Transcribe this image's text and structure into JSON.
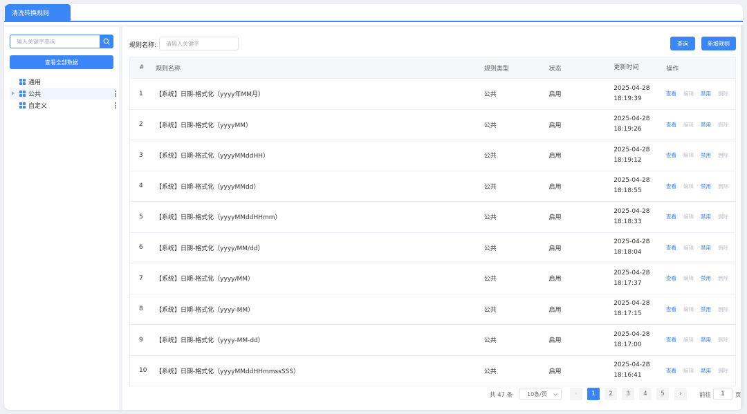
{
  "tab": {
    "label": "清洗转换规则"
  },
  "sidebar": {
    "search_placeholder": "输入关键字查询",
    "view_all_label": "查看全部数据",
    "tree": [
      {
        "label": "通用",
        "expandable": false,
        "selected": false,
        "more": false
      },
      {
        "label": "公共",
        "expandable": true,
        "selected": true,
        "more": true
      },
      {
        "label": "自定义",
        "expandable": false,
        "selected": false,
        "more": true
      }
    ]
  },
  "filter": {
    "label": "规则名称:",
    "placeholder": "请输入关键字",
    "query_label": "查询",
    "add_label": "新增规则"
  },
  "table": {
    "headers": {
      "idx": "#",
      "name": "规则名称",
      "type": "规则类型",
      "status": "状态",
      "time": "更新时间",
      "ops": "操作"
    },
    "ops": {
      "view": "查看",
      "edit": "编辑",
      "disable": "禁用",
      "delete": "删除"
    },
    "rows": [
      {
        "idx": "1",
        "name": "【系统】日期-格式化（yyyy年MM月）",
        "type": "公共",
        "status": "启用",
        "date": "2025-04-28",
        "time": "18:19:39"
      },
      {
        "idx": "2",
        "name": "【系统】日期-格式化（yyyyMM）",
        "type": "公共",
        "status": "启用",
        "date": "2025-04-28",
        "time": "18:19:26"
      },
      {
        "idx": "3",
        "name": "【系统】日期-格式化（yyyyMMddHH）",
        "type": "公共",
        "status": "启用",
        "date": "2025-04-28",
        "time": "18:19:12"
      },
      {
        "idx": "4",
        "name": "【系统】日期-格式化（yyyyMMdd）",
        "type": "公共",
        "status": "启用",
        "date": "2025-04-28",
        "time": "18:18:55"
      },
      {
        "idx": "5",
        "name": "【系统】日期-格式化（yyyyMMddHHmm）",
        "type": "公共",
        "status": "启用",
        "date": "2025-04-28",
        "time": "18:18:33"
      },
      {
        "idx": "6",
        "name": "【系统】日期-格式化（yyyy/MM/dd）",
        "type": "公共",
        "status": "启用",
        "date": "2025-04-28",
        "time": "18:18:04"
      },
      {
        "idx": "7",
        "name": "【系统】日期-格式化（yyyy/MM）",
        "type": "公共",
        "status": "启用",
        "date": "2025-04-28",
        "time": "18:17:37"
      },
      {
        "idx": "8",
        "name": "【系统】日期-格式化（yyyy-MM）",
        "type": "公共",
        "status": "启用",
        "date": "2025-04-28",
        "time": "18:17:15"
      },
      {
        "idx": "9",
        "name": "【系统】日期-格式化（yyyy-MM-dd）",
        "type": "公共",
        "status": "启用",
        "date": "2025-04-28",
        "time": "18:17:00"
      },
      {
        "idx": "10",
        "name": "【系统】日期-格式化（yyyyMMddHHmmssSSS）",
        "type": "公共",
        "status": "启用",
        "date": "2025-04-28",
        "time": "18:16:41"
      }
    ]
  },
  "pagination": {
    "total_label": "共 47 条",
    "page_size": "10条/页",
    "prev": "‹",
    "next": "›",
    "pages": [
      "1",
      "2",
      "3",
      "4",
      "5"
    ],
    "current": "1",
    "goto_label": "前往",
    "goto_value": "1",
    "goto_unit": "页"
  },
  "colors": {
    "accent": "#3a86f7",
    "muted": "#c0c4cc"
  }
}
